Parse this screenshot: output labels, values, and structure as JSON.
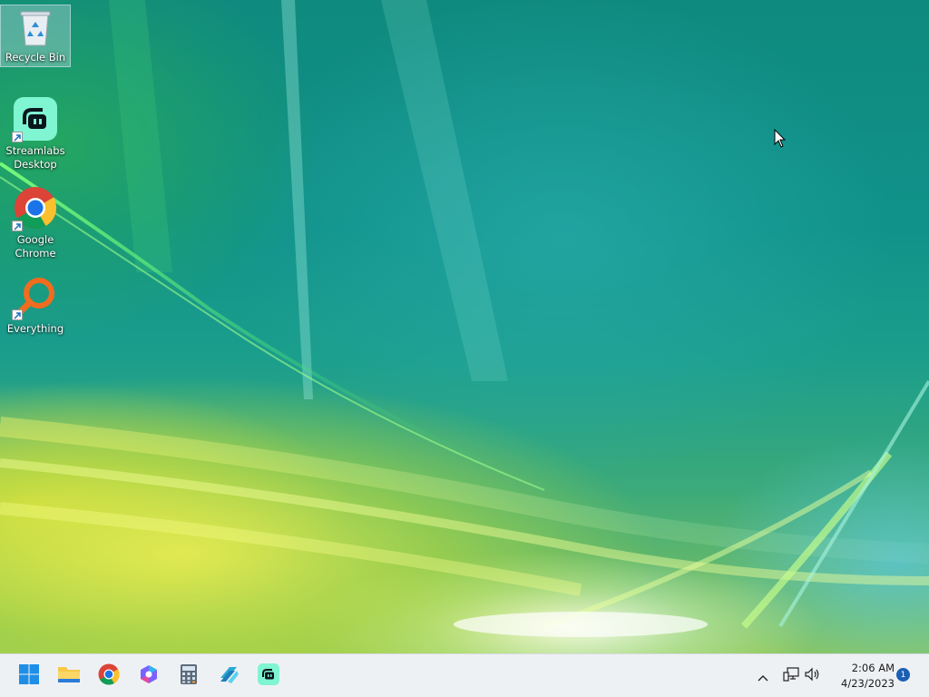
{
  "desktop": {
    "icons": [
      {
        "label": "Recycle Bin",
        "icon": "recycle-bin-icon"
      },
      {
        "label": "Streamlabs Desktop",
        "icon": "streamlabs-icon"
      },
      {
        "label": "Google Chrome",
        "icon": "chrome-icon"
      },
      {
        "label": "Everything",
        "icon": "everything-search-icon"
      }
    ]
  },
  "taskbar": {
    "apps": [
      {
        "icon": "windows-start-icon"
      },
      {
        "icon": "file-explorer-icon"
      },
      {
        "icon": "chrome-icon"
      },
      {
        "icon": "copilot-icon"
      },
      {
        "icon": "calculator-icon"
      },
      {
        "icon": "azure-data-studio-icon"
      },
      {
        "icon": "streamlabs-icon"
      }
    ],
    "tray": {
      "chevron_icon": "chevron-up-icon",
      "network_icon": "network-icon",
      "volume_icon": "volume-icon",
      "time": "2:06 AM",
      "date": "4/23/2023",
      "notification_count": "1"
    }
  },
  "colors": {
    "taskbar_bg": "#eef1f4",
    "streamlabs_accent": "#80f5d2",
    "chrome_blue": "#1a73e8",
    "everything_orange": "#f06c1e",
    "badge_blue": "#1a5fb4"
  }
}
